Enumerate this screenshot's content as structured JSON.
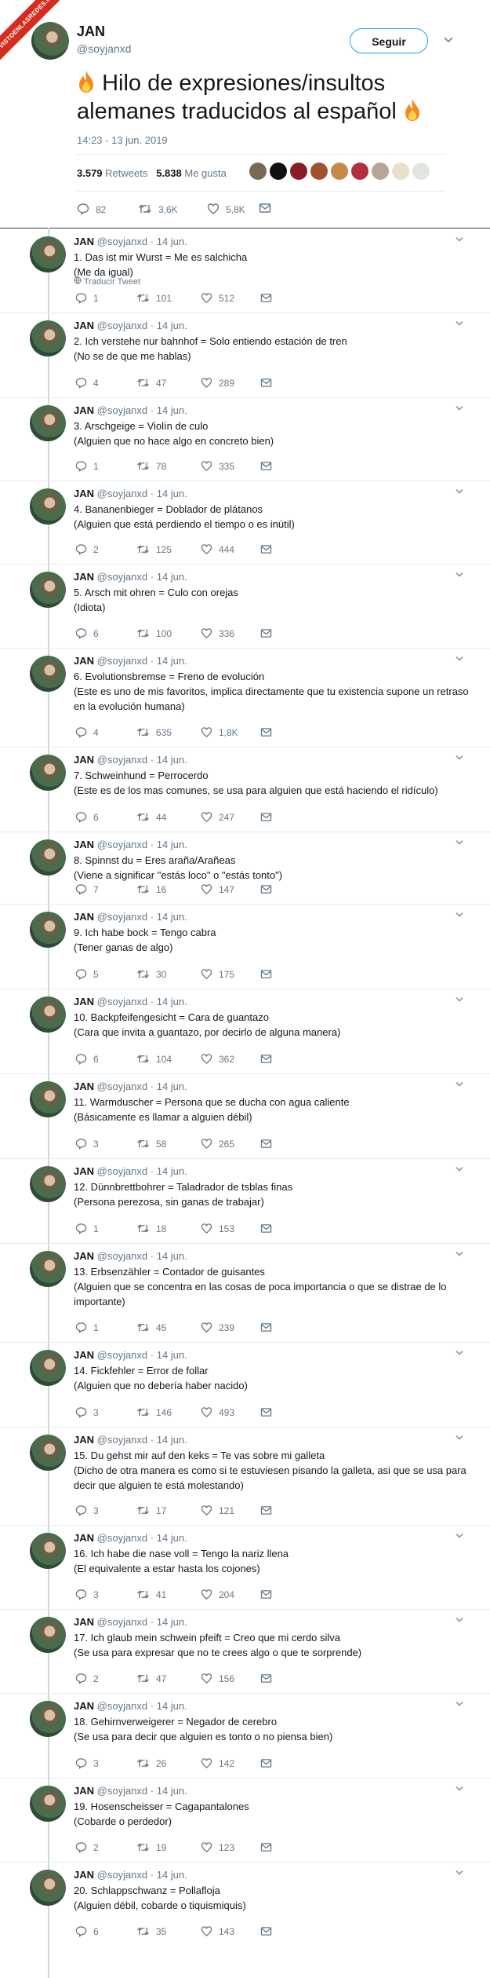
{
  "watermark": "VISTOENLASREDES.com",
  "main_tweet": {
    "name": "JAN",
    "handle": "@soyjanxd",
    "follow_label": "Seguir",
    "headline": "Hilo de expresiones/insultos alemanes traducidos al español",
    "time": "14:23 - 13 jun. 2019",
    "retweets_count": "3.579",
    "retweets_label": "Retweets",
    "likes_count": "5.838",
    "likes_label": "Me gusta",
    "replies": "82",
    "retweets_short": "3,6K",
    "likes_short": "5,8K"
  },
  "reply_meta": {
    "name": "JAN",
    "handle": "@soyjanxd",
    "date": "· 14 jun."
  },
  "translate_label": "Traducir Tweet",
  "tweets": [
    {
      "lines": [
        "1. Das ist mir Wurst = Me es salchicha",
        "(Me da igual)"
      ],
      "replies": "1",
      "retweets": "101",
      "likes": "512"
    },
    {
      "lines": [
        "2. Ich verstehe nur bahnhof = Solo entiendo estación de tren",
        "(No se de que me hablas)"
      ],
      "replies": "4",
      "retweets": "47",
      "likes": "289"
    },
    {
      "lines": [
        "3. Arschgeige = Violín de culo",
        "(Alguien que no hace algo en concreto bien)"
      ],
      "replies": "1",
      "retweets": "78",
      "likes": "335"
    },
    {
      "lines": [
        "4. Bananenbieger = Doblador de plátanos",
        "(Alguien que está perdiendo el tiempo o es inútil)"
      ],
      "replies": "2",
      "retweets": "125",
      "likes": "444"
    },
    {
      "lines": [
        "5. Arsch mit ohren = Culo con orejas",
        "(Idiota)"
      ],
      "replies": "6",
      "retweets": "100",
      "likes": "336"
    },
    {
      "lines": [
        "6. Evolutionsbremse = Freno de evolución",
        "(Este es uno de mis favoritos, implica directamente que tu existencia supone un retraso en la evolución humana)"
      ],
      "replies": "4",
      "retweets": "635",
      "likes": "1,8K"
    },
    {
      "lines": [
        "7. Schweinhund = Perrocerdo",
        "(Este es de los mas comunes, se usa para alguien que está haciendo el ridículo)"
      ],
      "replies": "6",
      "retweets": "44",
      "likes": "247"
    },
    {
      "lines": [
        "8. Spinnst du = Eres araña/Arañeas",
        "(Viene a significar \"estás loco\" o \"estás tonto\")"
      ],
      "replies": "7",
      "retweets": "16",
      "likes": "147"
    },
    {
      "lines": [
        "9. Ich habe bock = Tengo cabra",
        "(Tener ganas de algo)"
      ],
      "replies": "5",
      "retweets": "30",
      "likes": "175"
    },
    {
      "lines": [
        "10. Backpfeifengesicht = Cara de guantazo",
        "(Cara que invita a guantazo, por decirlo de alguna manera)"
      ],
      "replies": "6",
      "retweets": "104",
      "likes": "362"
    },
    {
      "lines": [
        "11. Warmduscher = Persona que se ducha con agua caliente",
        "(Básicamente es llamar a alguien débil)"
      ],
      "replies": "3",
      "retweets": "58",
      "likes": "265"
    },
    {
      "lines": [
        "12. Dünnbrettbohrer = Taladrador de tsblas finas",
        "(Persona perezosa, sin ganas de trabajar)"
      ],
      "replies": "1",
      "retweets": "18",
      "likes": "153"
    },
    {
      "lines": [
        "13. Erbsenzähler = Contador de guisantes",
        "(Alguien que se concentra en las cosas de poca importancia o que se distrae de lo importante)"
      ],
      "replies": "1",
      "retweets": "45",
      "likes": "239"
    },
    {
      "lines": [
        "14. Fickfehler = Error de follar",
        "(Alguien que no debería haber nacido)"
      ],
      "replies": "3",
      "retweets": "146",
      "likes": "493"
    },
    {
      "lines": [
        "15. Du gehst mir auf den keks = Te vas sobre mi galleta",
        "(Dicho de otra manera es como si te estuviesen pisando la galleta, asi que se usa para decir que alguien te está molestando)"
      ],
      "replies": "3",
      "retweets": "17",
      "likes": "121"
    },
    {
      "lines": [
        "16. Ich habe die nase voll = Tengo la nariz llena",
        "(El equivalente a estar hasta los cojones)"
      ],
      "replies": "3",
      "retweets": "41",
      "likes": "204"
    },
    {
      "lines": [
        "17. Ich glaub mein schwein pfeift = Creo que mi cerdo silva",
        "(Se usa para expresar que no te crees algo o que te sorprende)"
      ],
      "replies": "2",
      "retweets": "47",
      "likes": "156"
    },
    {
      "lines": [
        "18. Gehirnverweigerer = Negador de cerebro",
        "(Se usa para decir que alguien es tonto o no piensa bien)"
      ],
      "replies": "3",
      "retweets": "26",
      "likes": "142"
    },
    {
      "lines": [
        "19. Hosenscheisser = Cagapantalones",
        "(Cobarde o perdedor)"
      ],
      "replies": "2",
      "retweets": "19",
      "likes": "123"
    },
    {
      "lines": [
        "20. Schlappschwanz = Pollafloja",
        "(Alguien débil, cobarde o tiquismiquis)"
      ],
      "replies": "6",
      "retweets": "35",
      "likes": "143"
    }
  ]
}
